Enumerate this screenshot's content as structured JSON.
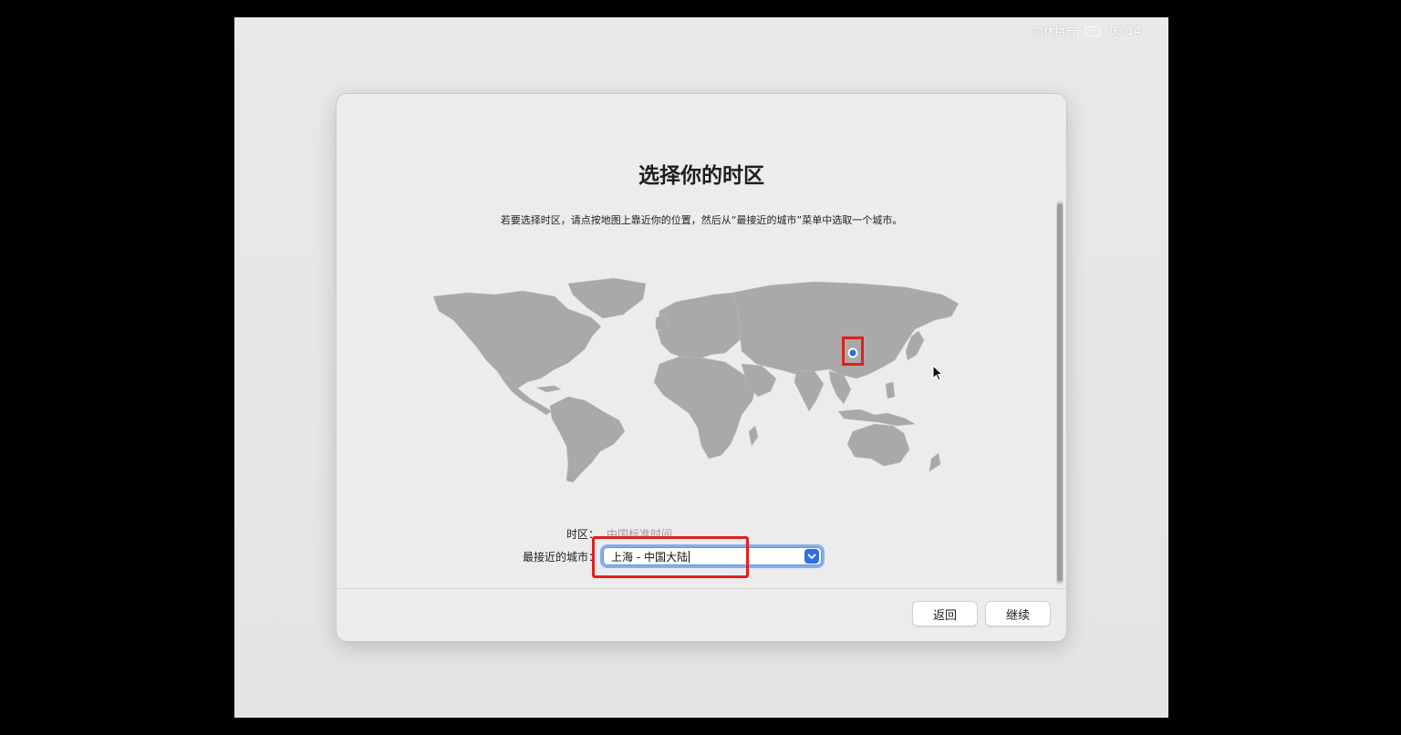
{
  "menubar": {
    "input_method": "简体拼音",
    "keyboard_icon": "keyboard-icon",
    "time": "03:14"
  },
  "dialog": {
    "title": "选择你的时区",
    "subtitle": "若要选择时区，请点按地图上靠近你的位置，然后从“最接近的城市”菜单中选取一个城市。",
    "timezone_label": "时区：",
    "timezone_value": "中国标准时间",
    "city_label": "最接近的城市：",
    "city_value": "上海 - 中国大陆",
    "back_label": "返回",
    "continue_label": "继续"
  },
  "colors": {
    "map_land": "#a9a9a9",
    "accent": "#2f6ee5",
    "highlight": "#e0201d"
  }
}
